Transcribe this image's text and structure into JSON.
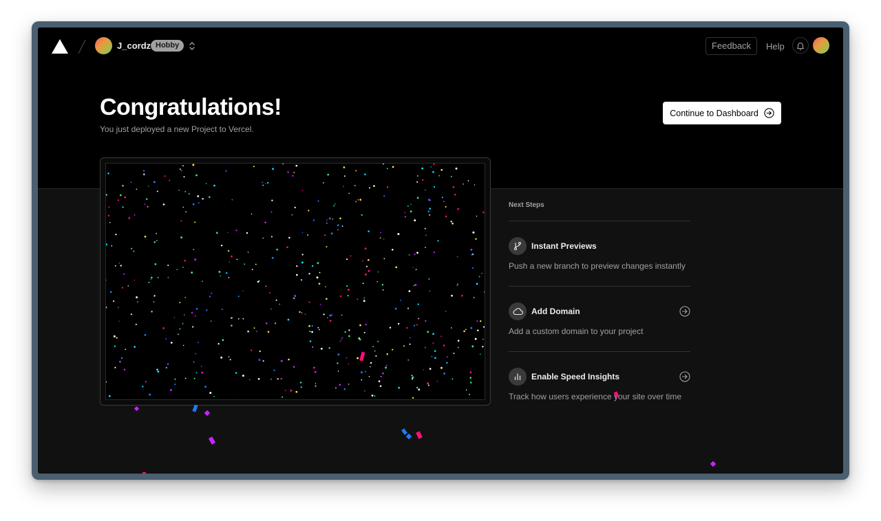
{
  "header": {
    "team_name": "J_cordz",
    "plan": "Hobby",
    "feedback_label": "Feedback",
    "help_label": "Help"
  },
  "hero": {
    "title": "Congratulations!",
    "subtitle": "You just deployed a new Project to Vercel.",
    "continue_label": "Continue to Dashboard"
  },
  "next_steps": {
    "heading": "Next Steps",
    "items": [
      {
        "title": "Instant Previews",
        "description": "Push a new branch to preview changes instantly",
        "icon": "git-branch-icon"
      },
      {
        "title": "Add Domain",
        "description": "Add a custom domain to your project",
        "icon": "cloud-icon"
      },
      {
        "title": "Enable Speed Insights",
        "description": "Track how users experience your site over time",
        "icon": "bar-chart-icon"
      }
    ]
  },
  "colors": {
    "background": "#000000",
    "panel": "#111111",
    "text_primary": "#ededed",
    "text_secondary": "#a1a1a1",
    "confetti": [
      "#ff0f7b",
      "#1f7bff",
      "#c724ff",
      "#3ae374",
      "#ffe14d",
      "#00e5ff"
    ]
  }
}
